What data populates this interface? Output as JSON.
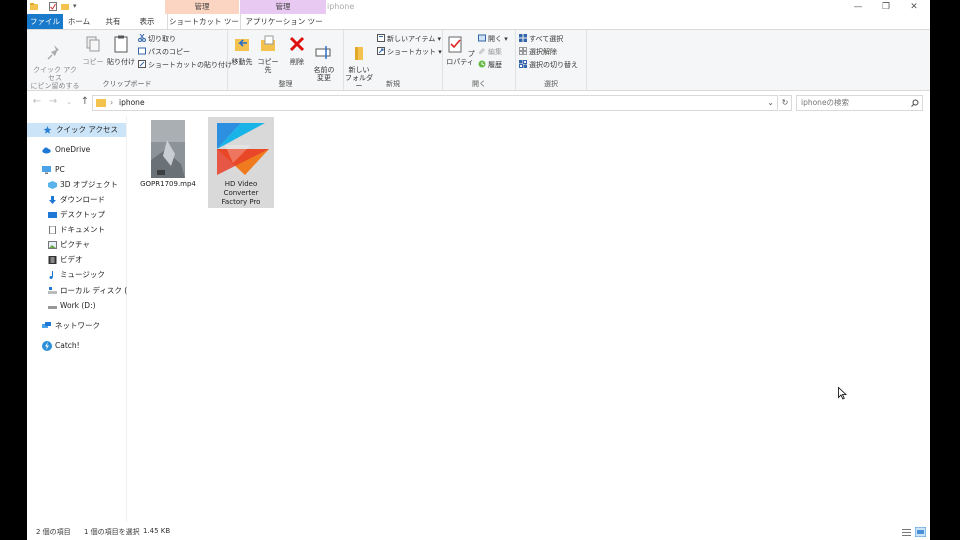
{
  "window": {
    "title": "iphone"
  },
  "title_bar": {
    "context_tab_shortcut": "管理",
    "context_tab_app": "管理",
    "minimize": "—",
    "maximize": "❐",
    "close": "✕"
  },
  "tabs": {
    "file": "ファイル",
    "home": "ホーム",
    "share": "共有",
    "view": "表示",
    "shortcut_tools": "ショートカット ツール",
    "app_tools": "アプリケーション ツール"
  },
  "ribbon": {
    "clipboard": {
      "label": "クリップボード",
      "pin": "クイック アクセス\nにピン留めする",
      "copy": "コピー",
      "paste": "貼り付け",
      "cut": "切り取り",
      "copy_path": "パスのコピー",
      "paste_shortcut": "ショートカットの貼り付け"
    },
    "organize": {
      "label": "整理",
      "move_to": "移動先",
      "copy_to": "コピー先",
      "delete": "削除",
      "rename": "名前の\n変更"
    },
    "new": {
      "label": "新規",
      "new_folder": "新しい\nフォルダー",
      "new_item": "新しいアイテム ▾",
      "shortcut": "ショートカット ▾"
    },
    "open": {
      "label": "開く",
      "properties": "プロパティ",
      "open": "開く ▾",
      "edit": "編集",
      "history": "履歴"
    },
    "select": {
      "label": "選択",
      "select_all": "すべて選択",
      "select_none": "選択解除",
      "invert": "選択の切り替え"
    }
  },
  "address": {
    "path": "iphone",
    "search_placeholder": "iphoneの検索"
  },
  "nav_pane": {
    "quick_access": "クイック アクセス",
    "onedrive": "OneDrive",
    "pc": "PC",
    "objects_3d": "3D オブジェクト",
    "downloads": "ダウンロード",
    "desktop": "デスクトップ",
    "documents": "ドキュメント",
    "pictures": "ピクチャ",
    "videos": "ビデオ",
    "music": "ミュージック",
    "local_disk": "ローカル ディスク (C:)",
    "work": "Work (D:)",
    "network": "ネットワーク",
    "catch": "Catch!"
  },
  "files": [
    {
      "name": "GOPR1709.mp4",
      "icon": "video-thumbnail"
    },
    {
      "name": "HD Video Converter Factory Pro",
      "icon": "app-shortcut-icon"
    }
  ],
  "status": {
    "item_count": "2 個の項目",
    "selected": "1 個の項目を選択",
    "size": "1.45 KB"
  },
  "colors": {
    "file_tab": "#1979ca",
    "selected": "#cce4f7",
    "ctx_shortcut": "#fbd5c2",
    "ctx_app": "#e8c9f2"
  }
}
